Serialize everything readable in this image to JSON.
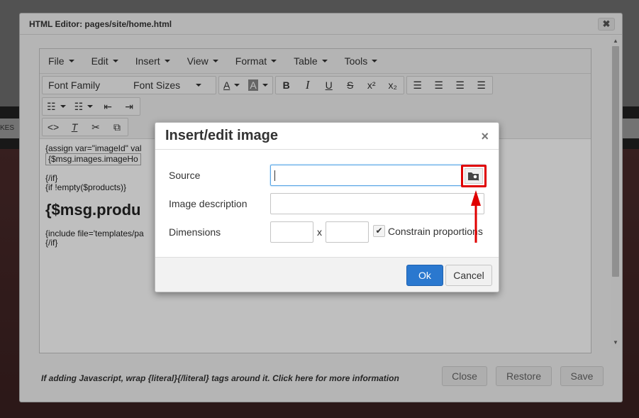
{
  "backdrop": {
    "nav_partial_label": "KES"
  },
  "outer_modal": {
    "title": "HTML Editor: pages/site/home.html",
    "close_glyph": "✖"
  },
  "editor": {
    "menus": [
      "File",
      "Edit",
      "Insert",
      "View",
      "Format",
      "Table",
      "Tools"
    ],
    "font_family_label": "Font Family",
    "font_sizes_label": "Font Sizes",
    "content_lines": {
      "line1": "{assign var=\"imageId\" val",
      "broken_image_alt": "{$msg.images.imageHo",
      "line3": "{/if}",
      "line4": "{if !empty($products)}",
      "heading": "{$msg.produ",
      "line6": "{include file='templates/pa",
      "line7": "{/if}"
    }
  },
  "footer": {
    "note": "If adding Javascript, wrap {literal}{/literal} tags around it. Click here for more information",
    "close_label": "Close",
    "restore_label": "Restore",
    "save_label": "Save"
  },
  "dialog": {
    "title": "Insert/edit image",
    "close_glyph": "×",
    "source_label": "Source",
    "source_value": "",
    "description_label": "Image description",
    "description_value": "",
    "dimensions_label": "Dimensions",
    "width_value": "",
    "height_value": "",
    "dim_separator": "x",
    "constrain_label": "Constrain proportions",
    "constrain_checked": true,
    "ok_label": "Ok",
    "cancel_label": "Cancel"
  },
  "colors": {
    "highlight": "#e00000",
    "primary_button": "#2a78cf"
  }
}
